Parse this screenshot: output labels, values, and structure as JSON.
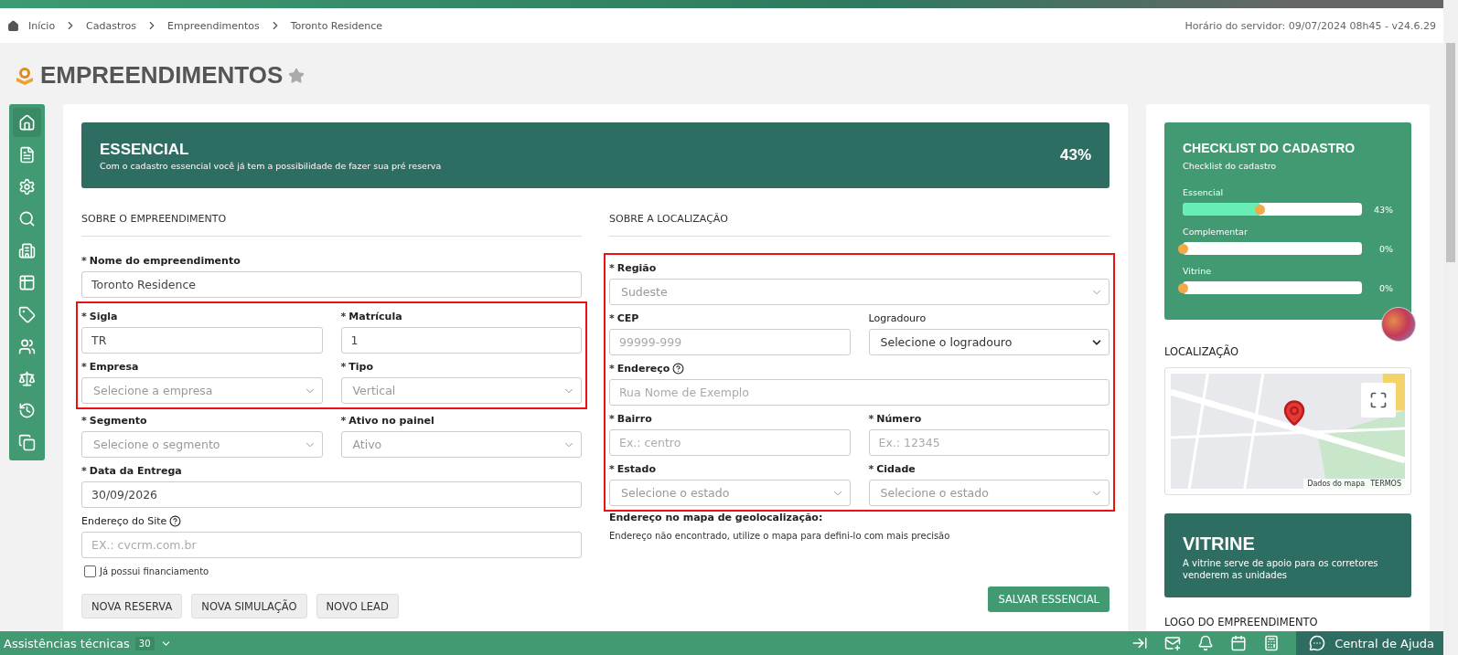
{
  "breadcrumb": [
    {
      "label": "Início",
      "kind": "home"
    },
    {
      "label": "Cadastros",
      "kind": "link"
    },
    {
      "label": "Empreendimentos",
      "kind": "link"
    },
    {
      "label": "Toronto Residence",
      "kind": "link"
    }
  ],
  "server_time": "Horário do servidor: 09/07/2024 08h45 - v24.6.29",
  "page_title": "EMPREENDIMENTOS",
  "sidebar": {
    "items": [
      {
        "selected": true
      },
      {
        "selected": false
      },
      {
        "selected": false
      },
      {
        "selected": false
      },
      {
        "selected": false
      },
      {
        "selected": false
      },
      {
        "selected": false
      },
      {
        "selected": false
      },
      {
        "selected": false
      },
      {
        "selected": false
      },
      {
        "selected": false
      }
    ]
  },
  "banner": {
    "title": "ESSENCIAL",
    "subtitle": "Com o cadastro essencial você já tem a possibilidade de fazer sua pré reserva",
    "percent": "43%"
  },
  "sections": [
    {
      "heading": "SOBRE O EMPREENDIMENTO",
      "groups": [
        {
          "highlighted": false,
          "rows": [
            [
              {
                "label": "Nome do empreendimento",
                "required_mark": "*",
                "kind": "text",
                "value": "Toronto Residence"
              }
            ]
          ]
        },
        {
          "highlighted": true,
          "rows": [
            [
              {
                "label": "Sigla",
                "required_mark": "*",
                "kind": "text",
                "value": "TR"
              },
              {
                "label": "Matrícula",
                "required_mark": "*",
                "kind": "text",
                "value": "1"
              }
            ],
            [
              {
                "label": "Empresa",
                "required_mark": "*",
                "kind": "select",
                "placeholder": "Selecione a empresa"
              },
              {
                "label": "Tipo",
                "required_mark": "*",
                "kind": "select",
                "value": "Vertical"
              }
            ]
          ]
        },
        {
          "highlighted": false,
          "rows": [
            [
              {
                "label": "Segmento",
                "required_mark": "*",
                "kind": "select",
                "placeholder": "Selecione o segmento"
              },
              {
                "label": "Ativo no painel",
                "required_mark": "*",
                "kind": "select",
                "value": "Ativo"
              }
            ],
            [
              {
                "label": "Data da Entrega",
                "required_mark": "*",
                "kind": "text",
                "value": "30/09/2026"
              }
            ],
            [
              {
                "label": "Endereço do Site",
                "help": true,
                "kind": "text",
                "placeholder": "EX.: cvcrm.com.br"
              }
            ]
          ]
        }
      ]
    },
    {
      "heading": "SOBRE A LOCALIZAÇÃO",
      "groups": [
        {
          "highlighted": true,
          "rows": [
            [
              {
                "label": "Região",
                "required_mark": "*",
                "kind": "select",
                "value": "Sudeste"
              }
            ],
            [
              {
                "label": "CEP",
                "required_mark": "*",
                "kind": "text",
                "placeholder": "99999-999"
              },
              {
                "label": "Logradouro",
                "kind": "dropdown",
                "value": "Selecione o logradouro"
              }
            ],
            [
              {
                "label": "Endereço",
                "required_mark": "*",
                "help": true,
                "kind": "text",
                "placeholder": "Rua Nome de Exemplo"
              }
            ],
            [
              {
                "label": "Bairro",
                "required_mark": "*",
                "kind": "text",
                "placeholder": "Ex.: centro"
              },
              {
                "label": "Número",
                "required_mark": "*",
                "kind": "text",
                "placeholder": "Ex.: 12345"
              }
            ],
            [
              {
                "label": "Estado",
                "required_mark": "*",
                "kind": "select",
                "placeholder": "Selecione o estado"
              },
              {
                "label": "Cidade",
                "required_mark": "*",
                "kind": "select",
                "placeholder": "Selecione o estado"
              }
            ]
          ]
        }
      ]
    }
  ],
  "financing": {
    "label": "Já possui financiamento",
    "checked": false
  },
  "geo": {
    "title": "Endereço no mapa de geolocalização:",
    "note": "Endereço não encontrado, utilize o mapa para defini-lo com mais precisão"
  },
  "actions": [
    "NOVA RESERVA",
    "NOVA SIMULAÇÃO",
    "NOVO LEAD"
  ],
  "save_button": "SALVAR ESSENCIAL",
  "checklist": {
    "title": "CHECKLIST DO CADASTRO",
    "subtitle": "Checklist do cadastro",
    "items": [
      {
        "label": "Essencial",
        "level": 0.43,
        "reading": "43%"
      },
      {
        "label": "Complementar",
        "level": 0,
        "reading": "0%"
      },
      {
        "label": "Vitrine",
        "level": 0,
        "reading": "0%"
      }
    ]
  },
  "location": {
    "heading": "LOCALIZAÇÃO",
    "map_data": "Dados do mapa",
    "terms": "TERMOS"
  },
  "vitrine": {
    "title": "VITRINE",
    "text": "A vitrine serve de apoio para os corretores venderem as unidades"
  },
  "logo_heading": "LOGO DO EMPREENDIMENTO",
  "footer": {
    "label": "Assistências técnicas",
    "count": "30",
    "help": "Central de Ajuda"
  }
}
